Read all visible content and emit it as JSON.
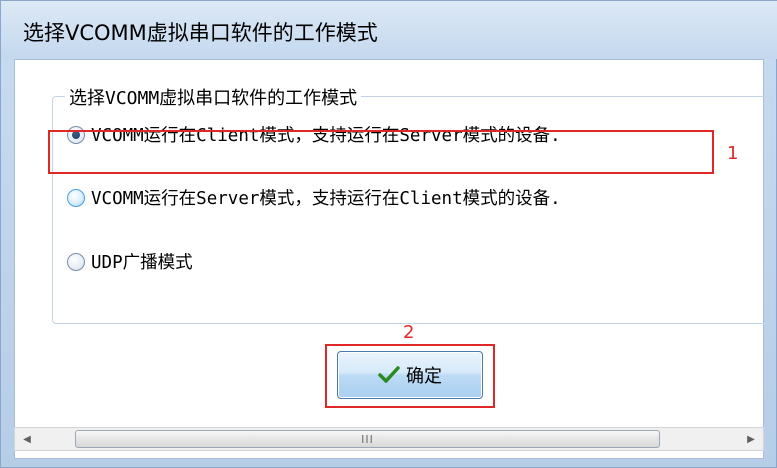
{
  "window": {
    "title": "选择VCOMM虚拟串口软件的工作模式"
  },
  "group": {
    "legend": "选择VCOMM虚拟串口软件的工作模式"
  },
  "options": [
    {
      "label": "VCOMM运行在Client模式，支持运行在Server模式的设备.",
      "checked": true
    },
    {
      "label": "VCOMM运行在Server模式，支持运行在Client模式的设备.",
      "checked": false
    },
    {
      "label": "UDP广播模式",
      "checked": false
    }
  ],
  "annotations": {
    "marker_1": "1",
    "marker_2": "2"
  },
  "buttons": {
    "ok_label": "确定"
  },
  "scrollbar": {
    "left_arrow": "◀",
    "right_arrow": "▶",
    "grip": "III"
  },
  "colors": {
    "annotation_red": "#e02828",
    "check_green": "#2a8a1e"
  },
  "icons": {
    "ok_icon": "checkmark-icon"
  }
}
